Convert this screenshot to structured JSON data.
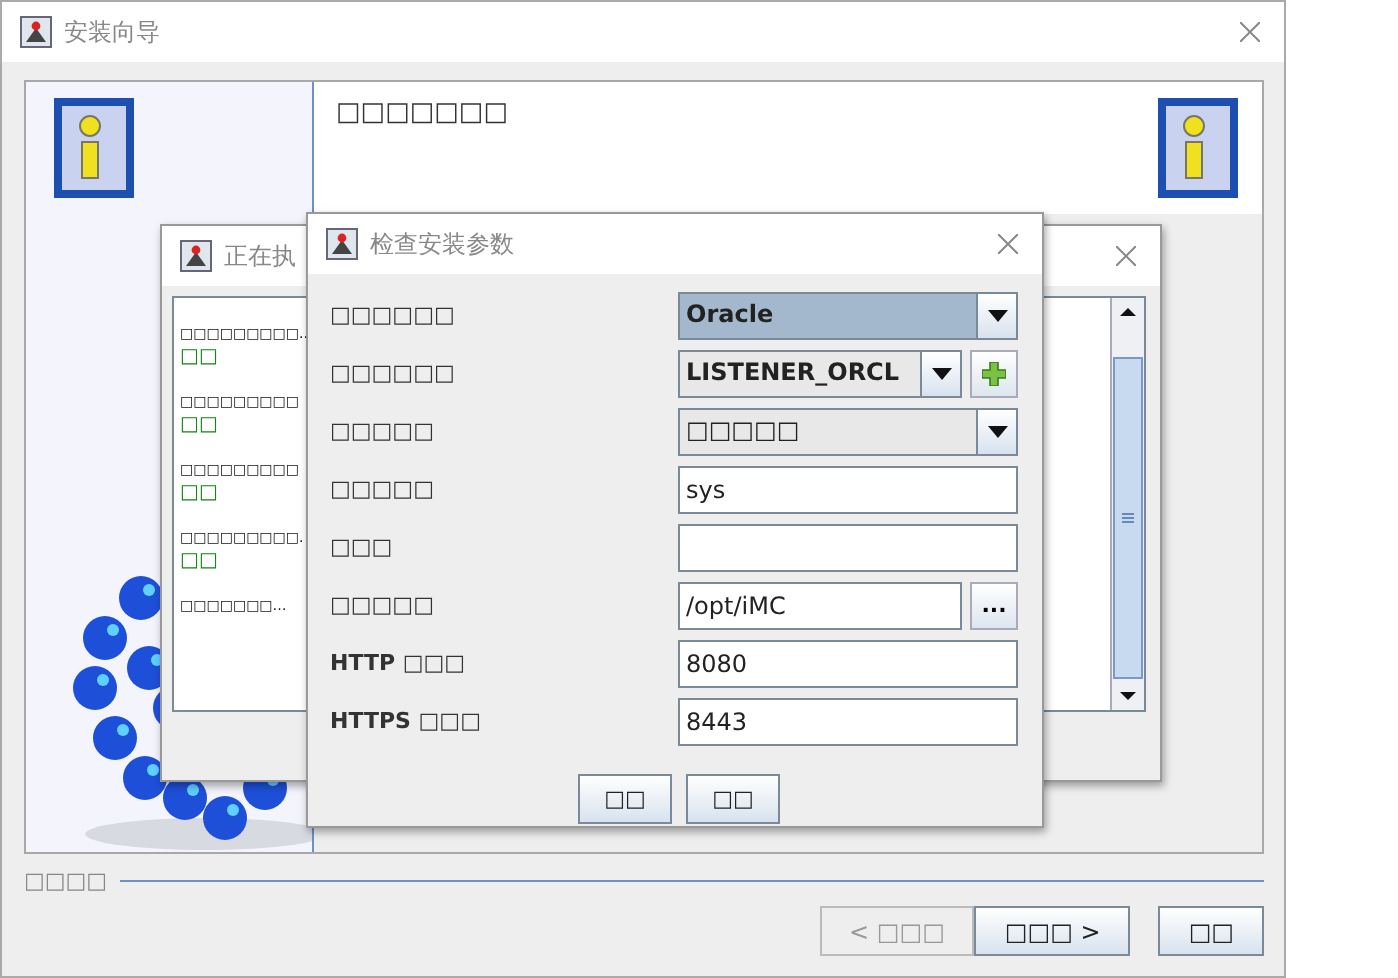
{
  "window": {
    "title": "安装向导",
    "header": "□□□□□□□",
    "footer_label": "□□□□",
    "buttons": [
      {
        "label": "< □□□",
        "disabled": true
      },
      {
        "label": "□□□ >",
        "disabled": false
      },
      {
        "label": "□□",
        "disabled": false
      }
    ]
  },
  "progress_dialog": {
    "title": "正在执",
    "steps": [
      {
        "text": "□□□□□□□□□..",
        "status": "□□"
      },
      {
        "text": "□□□□□□□□□",
        "status": "□□"
      },
      {
        "text": "□□□□□□□□□",
        "status": "□□"
      },
      {
        "text": "□□□□□□□□□.",
        "status": "□□"
      },
      {
        "text": "□□□□□□□…"
      }
    ]
  },
  "check_dialog": {
    "title": "检查安装参数",
    "fields": [
      {
        "kind": "combo",
        "label": "□□□□□□",
        "value": "Oracle",
        "focused": true
      },
      {
        "kind": "combo_add",
        "label": "□□□□□□",
        "value": "LISTENER_ORCL",
        "focused": false
      },
      {
        "kind": "combo",
        "label": "□□□□□",
        "value": "□□□□□",
        "focused": false
      },
      {
        "kind": "text",
        "label": "□□□□□",
        "value": "sys"
      },
      {
        "kind": "text",
        "label": "□□□"
      },
      {
        "kind": "path",
        "label": "□□□□□",
        "value": "/opt/iMC",
        "button": "..."
      },
      {
        "kind": "text",
        "label": "HTTP □□□",
        "value": "8080"
      },
      {
        "kind": "text",
        "label": "HTTPS □□□",
        "value": "8443"
      }
    ],
    "buttons": [
      "□□",
      "□□"
    ]
  }
}
